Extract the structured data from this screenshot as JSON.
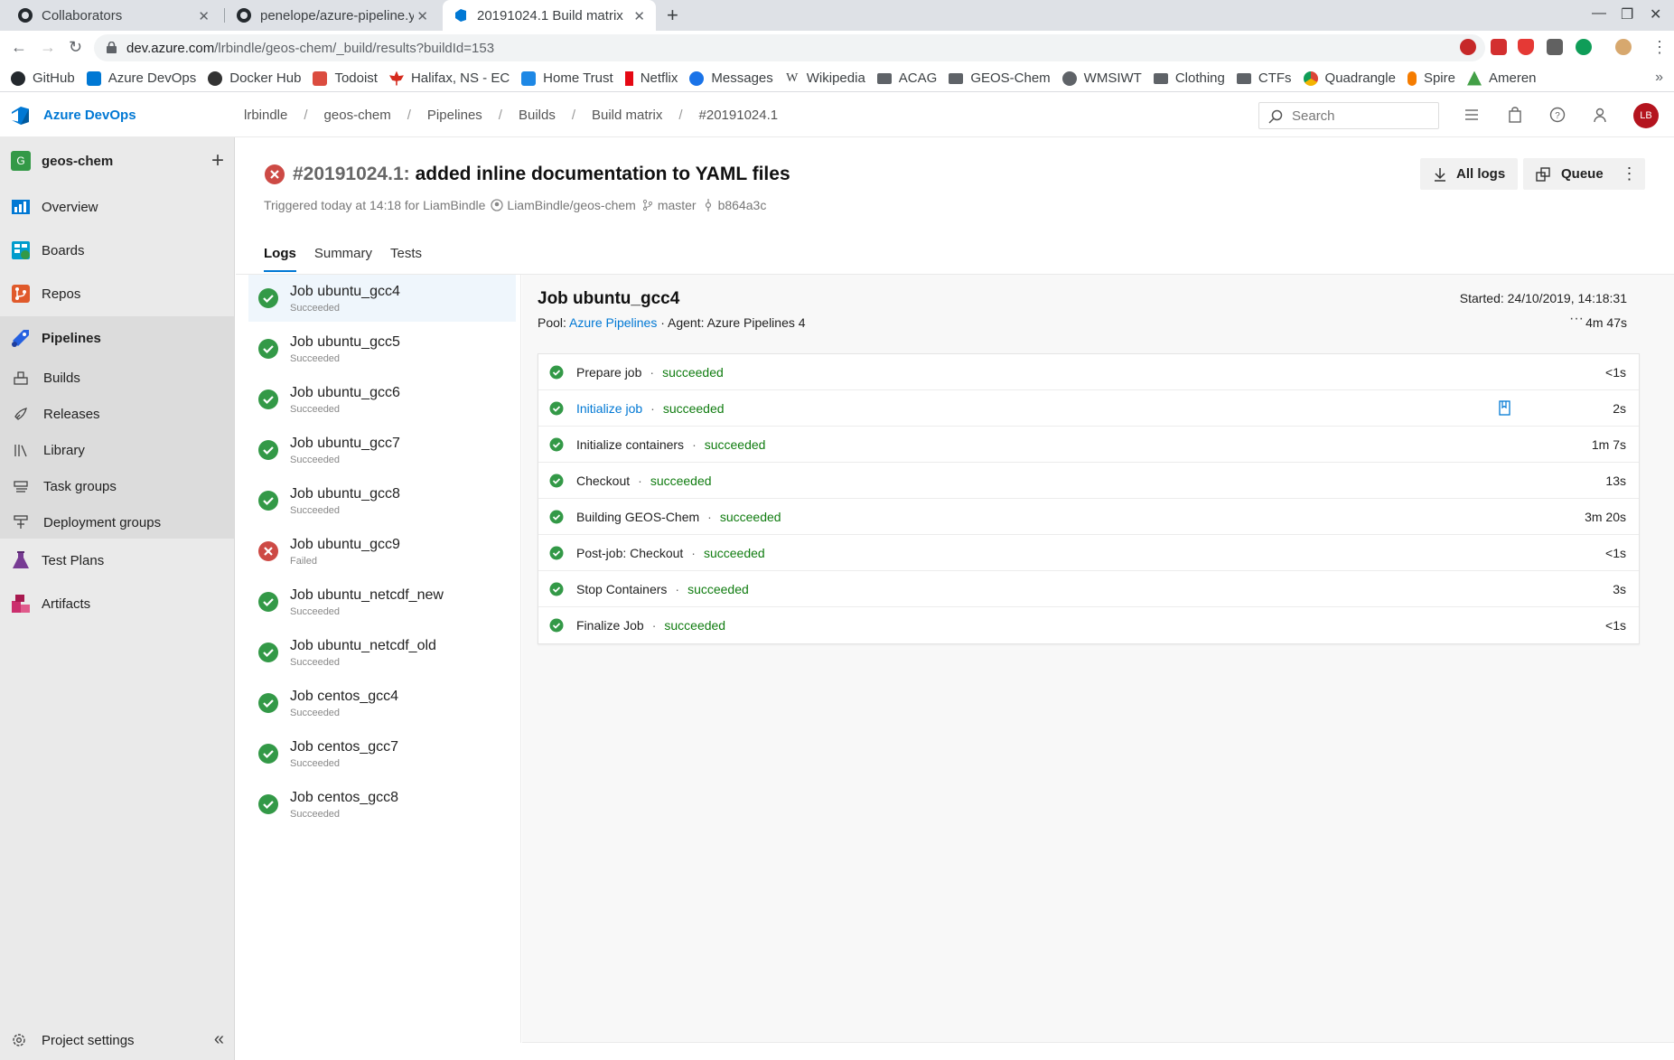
{
  "browser": {
    "tabs": [
      {
        "title": "Collaborators"
      },
      {
        "title": "penelope/azure-pipeline.y"
      },
      {
        "title": "20191024.1 Build matrix"
      }
    ],
    "url_host": "dev.azure.com",
    "url_path": "/lrbindle/geos-chem/_build/results?buildId=153",
    "bookmarks": [
      "GitHub",
      "Azure DevOps",
      "Docker Hub",
      "Todoist",
      "Halifax, NS - EC",
      "Home Trust",
      "Netflix",
      "Messages",
      "Wikipedia",
      "ACAG",
      "GEOS-Chem",
      "WMSIWT",
      "Clothing",
      "CTFs",
      "Quadrangle",
      "Spire",
      "Ameren"
    ]
  },
  "header": {
    "brand": "Azure DevOps",
    "breadcrumbs": [
      "lrbindle",
      "geos-chem",
      "Pipelines",
      "Builds",
      "Build matrix",
      "#20191024.1"
    ],
    "search_placeholder": "Search",
    "avatar_initials": "LB"
  },
  "sidebar": {
    "project_initial": "G",
    "project_name": "geos-chem",
    "items": [
      {
        "label": "Overview"
      },
      {
        "label": "Boards"
      },
      {
        "label": "Repos"
      },
      {
        "label": "Pipelines"
      }
    ],
    "subitems": [
      {
        "label": "Builds"
      },
      {
        "label": "Releases"
      },
      {
        "label": "Library"
      },
      {
        "label": "Task groups"
      },
      {
        "label": "Deployment groups"
      }
    ],
    "items_after": [
      {
        "label": "Test Plans"
      },
      {
        "label": "Artifacts"
      }
    ],
    "project_settings": "Project settings"
  },
  "build": {
    "number": "#20191024.1:",
    "title": "added inline documentation to YAML files",
    "trigger_text": "Triggered today at 14:18 for LiamBindle",
    "repo": "LiamBindle/geos-chem",
    "branch": "master",
    "commit": "b864a3c",
    "all_logs_label": "All logs",
    "queue_label": "Queue"
  },
  "tabs": [
    "Logs",
    "Summary",
    "Tests"
  ],
  "jobs": [
    {
      "name": "Job ubuntu_gcc4",
      "status": "Succeeded"
    },
    {
      "name": "Job ubuntu_gcc5",
      "status": "Succeeded"
    },
    {
      "name": "Job ubuntu_gcc6",
      "status": "Succeeded"
    },
    {
      "name": "Job ubuntu_gcc7",
      "status": "Succeeded"
    },
    {
      "name": "Job ubuntu_gcc8",
      "status": "Succeeded"
    },
    {
      "name": "Job ubuntu_gcc9",
      "status": "Failed"
    },
    {
      "name": "Job ubuntu_netcdf_new",
      "status": "Succeeded"
    },
    {
      "name": "Job ubuntu_netcdf_old",
      "status": "Succeeded"
    },
    {
      "name": "Job centos_gcc4",
      "status": "Succeeded"
    },
    {
      "name": "Job centos_gcc7",
      "status": "Succeeded"
    },
    {
      "name": "Job centos_gcc8",
      "status": "Succeeded"
    }
  ],
  "job_detail": {
    "title": "Job ubuntu_gcc4",
    "started": "Started: 24/10/2019, 14:18:31",
    "pool_label": "Pool:",
    "pool_name": "Azure Pipelines",
    "agent": "Agent: Azure Pipelines 4",
    "duration": "4m 47s",
    "steps": [
      {
        "name": "Prepare job",
        "status": "succeeded",
        "duration": "<1s"
      },
      {
        "name": "Initialize job",
        "status": "succeeded",
        "duration": "2s"
      },
      {
        "name": "Initialize containers",
        "status": "succeeded",
        "duration": "1m 7s"
      },
      {
        "name": "Checkout",
        "status": "succeeded",
        "duration": "13s"
      },
      {
        "name": "Building GEOS-Chem",
        "status": "succeeded",
        "duration": "3m 20s"
      },
      {
        "name": "Post-job: Checkout",
        "status": "succeeded",
        "duration": "<1s"
      },
      {
        "name": "Stop Containers",
        "status": "succeeded",
        "duration": "3s"
      },
      {
        "name": "Finalize Job",
        "status": "succeeded",
        "duration": "<1s"
      }
    ]
  },
  "colors": {
    "accent": "#0078d4",
    "success": "#339947",
    "failure": "#cd4a45",
    "success_text": "#107c10"
  }
}
